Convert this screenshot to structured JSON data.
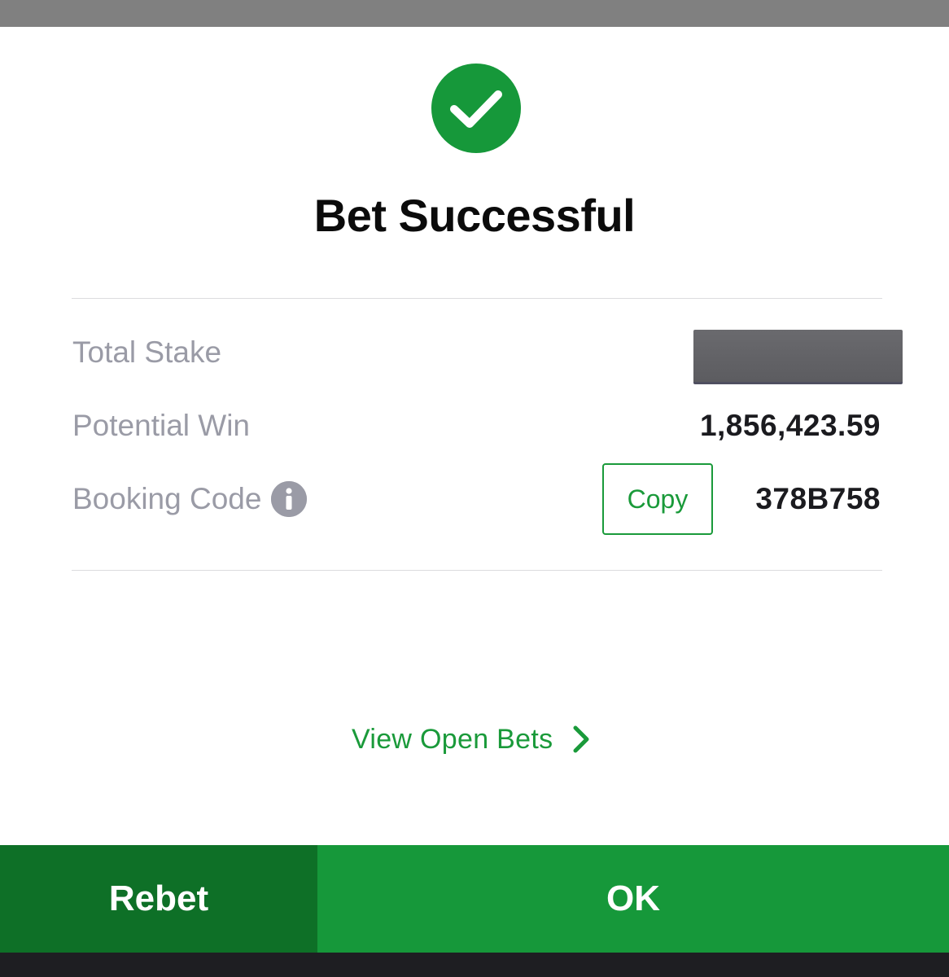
{
  "dialog": {
    "title": "Bet Successful",
    "status_icon": "check-circle-icon"
  },
  "summary": {
    "total_stake": {
      "label": "Total Stake",
      "value_redacted": true
    },
    "potential_win": {
      "label": "Potential Win",
      "value": "1,856,423.59"
    },
    "booking_code": {
      "label": "Booking Code",
      "info_icon": "info-icon",
      "copy_label": "Copy",
      "value": "378B758"
    }
  },
  "links": {
    "view_open_bets": "View Open Bets",
    "chevron_icon": "chevron-right-icon"
  },
  "footer": {
    "rebet_label": "Rebet",
    "ok_label": "OK"
  },
  "colors": {
    "success_green": "#16983A",
    "dark_green": "#0E7027",
    "label_gray": "#9A9BA6"
  }
}
